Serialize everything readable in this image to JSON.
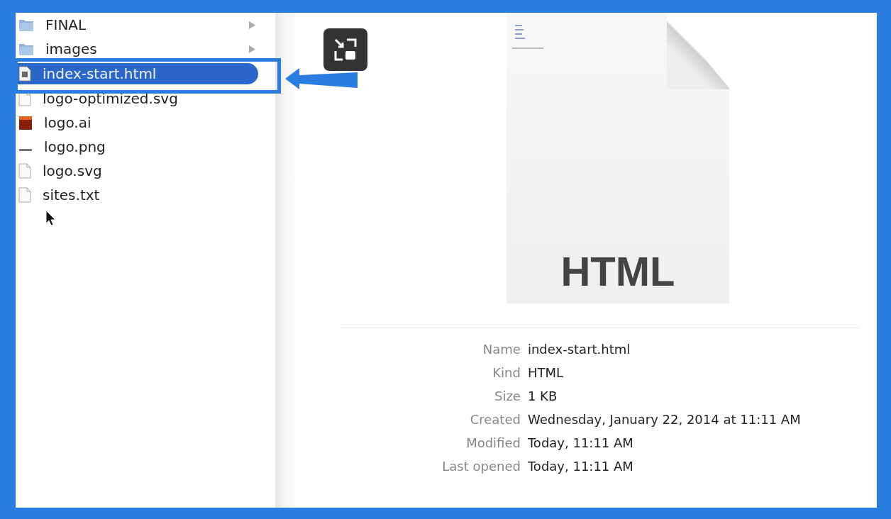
{
  "files": [
    {
      "name": "FINAL",
      "kind": "folder",
      "expandable": true,
      "selected": false
    },
    {
      "name": "images",
      "kind": "folder",
      "expandable": true,
      "selected": false
    },
    {
      "name": "index-start.html",
      "kind": "html",
      "expandable": false,
      "selected": true
    },
    {
      "name": "logo-optimized.svg",
      "kind": "doc",
      "expandable": false,
      "selected": false
    },
    {
      "name": "logo.ai",
      "kind": "ai",
      "expandable": false,
      "selected": false
    },
    {
      "name": "logo.png",
      "kind": "image",
      "expandable": false,
      "selected": false
    },
    {
      "name": "logo.svg",
      "kind": "doc",
      "expandable": false,
      "selected": false
    },
    {
      "name": "sites.txt",
      "kind": "doc",
      "expandable": false,
      "selected": false
    }
  ],
  "preview": {
    "icon_label": "HTML",
    "info": [
      {
        "label": "Name",
        "value": "index-start.html"
      },
      {
        "label": "Kind",
        "value": "HTML"
      },
      {
        "label": "Size",
        "value": "1 KB"
      },
      {
        "label": "Created",
        "value": "Wednesday, January 22, 2014 at 11:11 AM"
      },
      {
        "label": "Modified",
        "value": "Today, 11:11 AM"
      },
      {
        "label": "Last opened",
        "value": "Today, 11:11 AM"
      }
    ]
  }
}
